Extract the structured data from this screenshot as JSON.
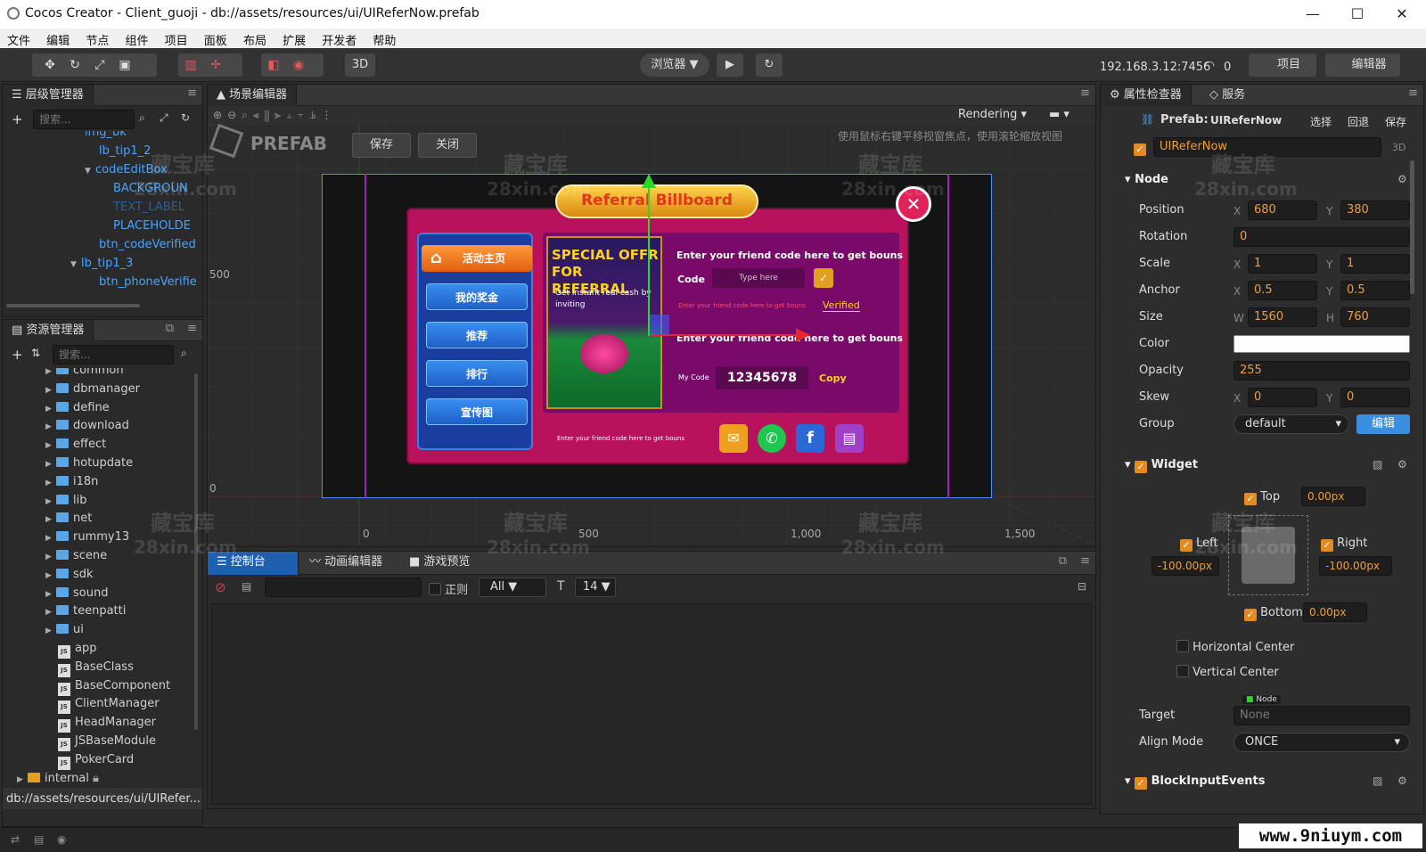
{
  "window": {
    "title": "Cocos Creator - Client_guoji - db://assets/resources/ui/UIReferNow.prefab",
    "minimize": "—",
    "maximize": "☐",
    "close": "✕"
  },
  "menu": [
    "文件",
    "编辑",
    "节点",
    "组件",
    "项目",
    "面板",
    "布局",
    "扩展",
    "开发者",
    "帮助"
  ],
  "toolbar": {
    "mode_3d": "3D",
    "browser": "浏览器 ▼",
    "ip": "192.168.3.12:7456",
    "count": "0",
    "project": "项目",
    "editor": "编辑器"
  },
  "hierarchy": {
    "title": "层级管理器",
    "search_placeholder": "搜索...",
    "items": [
      {
        "label": "img_bk"
      },
      {
        "label": "lb_tip1_2"
      },
      {
        "label": "codeEditBox"
      },
      {
        "label": "BACKGROUN"
      },
      {
        "label": "TEXT_LABEL"
      },
      {
        "label": "PLACEHOLDE"
      },
      {
        "label": "btn_codeVerified"
      },
      {
        "label": "lb_tip1_3"
      },
      {
        "label": "btn_phoneVerifie"
      }
    ]
  },
  "assets": {
    "title": "资源管理器",
    "search_placeholder": "搜索...",
    "items": [
      {
        "label": "common"
      },
      {
        "label": "dbmanager"
      },
      {
        "label": "define"
      },
      {
        "label": "download"
      },
      {
        "label": "effect"
      },
      {
        "label": "hotupdate"
      },
      {
        "label": "i18n"
      },
      {
        "label": "lib"
      },
      {
        "label": "net"
      },
      {
        "label": "rummy13"
      },
      {
        "label": "scene"
      },
      {
        "label": "sdk"
      },
      {
        "label": "sound"
      },
      {
        "label": "teenpatti"
      },
      {
        "label": "ui"
      },
      {
        "label": "app"
      },
      {
        "label": "BaseClass"
      },
      {
        "label": "BaseComponent"
      },
      {
        "label": "ClientManager"
      },
      {
        "label": "HeadManager"
      },
      {
        "label": "JSBaseModule"
      },
      {
        "label": "PokerCard"
      },
      {
        "label": "internal"
      }
    ],
    "path": "db://assets/resources/ui/UIRefer..."
  },
  "scene": {
    "title": "场景编辑器",
    "rendering": "Rendering",
    "prefab_label": "PREFAB",
    "save": "保存",
    "close": "关闭",
    "hint": "使用鼠标右键平移视窗焦点，使用滚轮缩放视图",
    "ruler_y": [
      "500",
      "0"
    ],
    "ruler_x": [
      "0",
      "500",
      "1,000",
      "1,500"
    ]
  },
  "game": {
    "title": "Referral Billboard",
    "menu": [
      "活动主页",
      "我的奖金",
      "推荐",
      "排行",
      "宣传图"
    ],
    "offer_title": "SPECIAL OFFR FOR REFERRAL",
    "offer_sub": "Get instant real cash by inviting",
    "enter1": "Enter your friend code here to get bouns",
    "code_label": "Code",
    "code_placeholder": "Type here",
    "small_hint": "Enter your friend code here to get bouns",
    "verified": "Verified",
    "enter2": "Enter your friend code here to get bouns",
    "my_code_label": "My Code",
    "my_code": "12345678",
    "copy": "Copy",
    "bottom_hint": "Enter your friend code here to get bouns"
  },
  "console": {
    "tabs": [
      "控制台",
      "动画编辑器",
      "游戏预览"
    ],
    "regex": "正则",
    "level": "All ▼",
    "font_size": "14 ▼"
  },
  "inspector": {
    "tabs": [
      "属性检查器",
      "服务"
    ],
    "prefab_label": "Prefab:",
    "prefab_name": "UIReferNow",
    "select": "选择",
    "revert": "回退",
    "save": "保存",
    "node_name": "UIReferNow",
    "three_d": "3D",
    "node_section": "Node",
    "position": {
      "label": "Position",
      "x": "680",
      "y": "380"
    },
    "rotation": {
      "label": "Rotation",
      "value": "0"
    },
    "scale": {
      "label": "Scale",
      "x": "1",
      "y": "1"
    },
    "anchor": {
      "label": "Anchor",
      "x": "0.5",
      "y": "0.5"
    },
    "size": {
      "label": "Size",
      "w": "1560",
      "h": "760"
    },
    "color": {
      "label": "Color",
      "value": "#ffffff"
    },
    "opacity": {
      "label": "Opacity",
      "value": "255"
    },
    "skew": {
      "label": "Skew",
      "x": "0",
      "y": "0"
    },
    "group": {
      "label": "Group",
      "value": "default",
      "edit": "编辑"
    },
    "widget": {
      "title": "Widget",
      "top": "Top",
      "top_val": "0.00px",
      "left": "Left",
      "left_val": "-100.00px",
      "right": "Right",
      "right_val": "-100.00px",
      "bottom": "Bottom",
      "bottom_val": "0.00px",
      "hcenter": "Horizontal Center",
      "vcenter": "Vertical Center",
      "target_label": "Target",
      "target_tag": "Node",
      "target_val": "None",
      "align_label": "Align Mode",
      "align_val": "ONCE"
    },
    "block": {
      "title": "BlockInputEvents"
    }
  },
  "watermark": {
    "text1": "藏宝库",
    "text2": "28xin.com",
    "site": "www.9niuym.com"
  }
}
